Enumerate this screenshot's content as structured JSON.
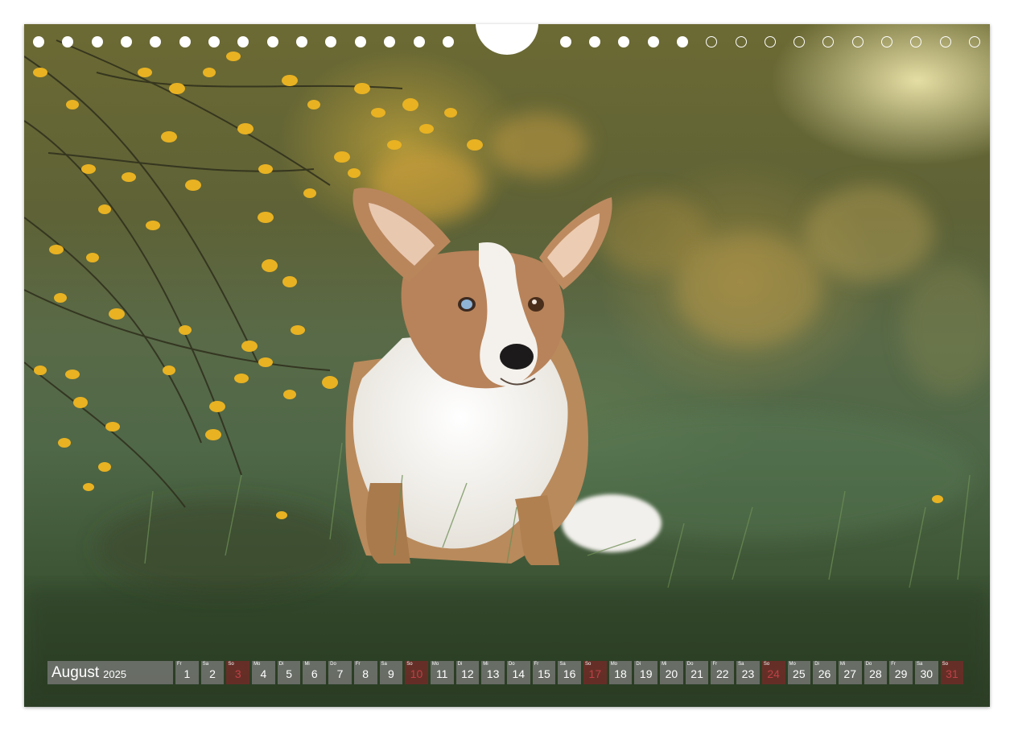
{
  "calendar": {
    "month": "August",
    "year": "2025",
    "days": [
      {
        "wd": "Fr",
        "d": "1"
      },
      {
        "wd": "Sa",
        "d": "2"
      },
      {
        "wd": "So",
        "d": "3",
        "sunday": true
      },
      {
        "wd": "Mo",
        "d": "4"
      },
      {
        "wd": "Di",
        "d": "5"
      },
      {
        "wd": "Mi",
        "d": "6"
      },
      {
        "wd": "Do",
        "d": "7"
      },
      {
        "wd": "Fr",
        "d": "8"
      },
      {
        "wd": "Sa",
        "d": "9"
      },
      {
        "wd": "So",
        "d": "10",
        "sunday": true
      },
      {
        "wd": "Mo",
        "d": "11"
      },
      {
        "wd": "Di",
        "d": "12"
      },
      {
        "wd": "Mi",
        "d": "13"
      },
      {
        "wd": "Do",
        "d": "14"
      },
      {
        "wd": "Fr",
        "d": "15"
      },
      {
        "wd": "Sa",
        "d": "16"
      },
      {
        "wd": "So",
        "d": "17",
        "sunday": true
      },
      {
        "wd": "Mo",
        "d": "18"
      },
      {
        "wd": "Di",
        "d": "19"
      },
      {
        "wd": "Mi",
        "d": "20"
      },
      {
        "wd": "Do",
        "d": "21"
      },
      {
        "wd": "Fr",
        "d": "22"
      },
      {
        "wd": "Sa",
        "d": "23"
      },
      {
        "wd": "So",
        "d": "24",
        "sunday": true
      },
      {
        "wd": "Mo",
        "d": "25"
      },
      {
        "wd": "Di",
        "d": "26"
      },
      {
        "wd": "Mi",
        "d": "27"
      },
      {
        "wd": "Do",
        "d": "28"
      },
      {
        "wd": "Fr",
        "d": "29"
      },
      {
        "wd": "Sa",
        "d": "30"
      },
      {
        "wd": "So",
        "d": "31",
        "sunday": true
      }
    ]
  },
  "colors": {
    "sunday": "#c04048",
    "bar": "#808080",
    "flowers": "#e8b222"
  }
}
